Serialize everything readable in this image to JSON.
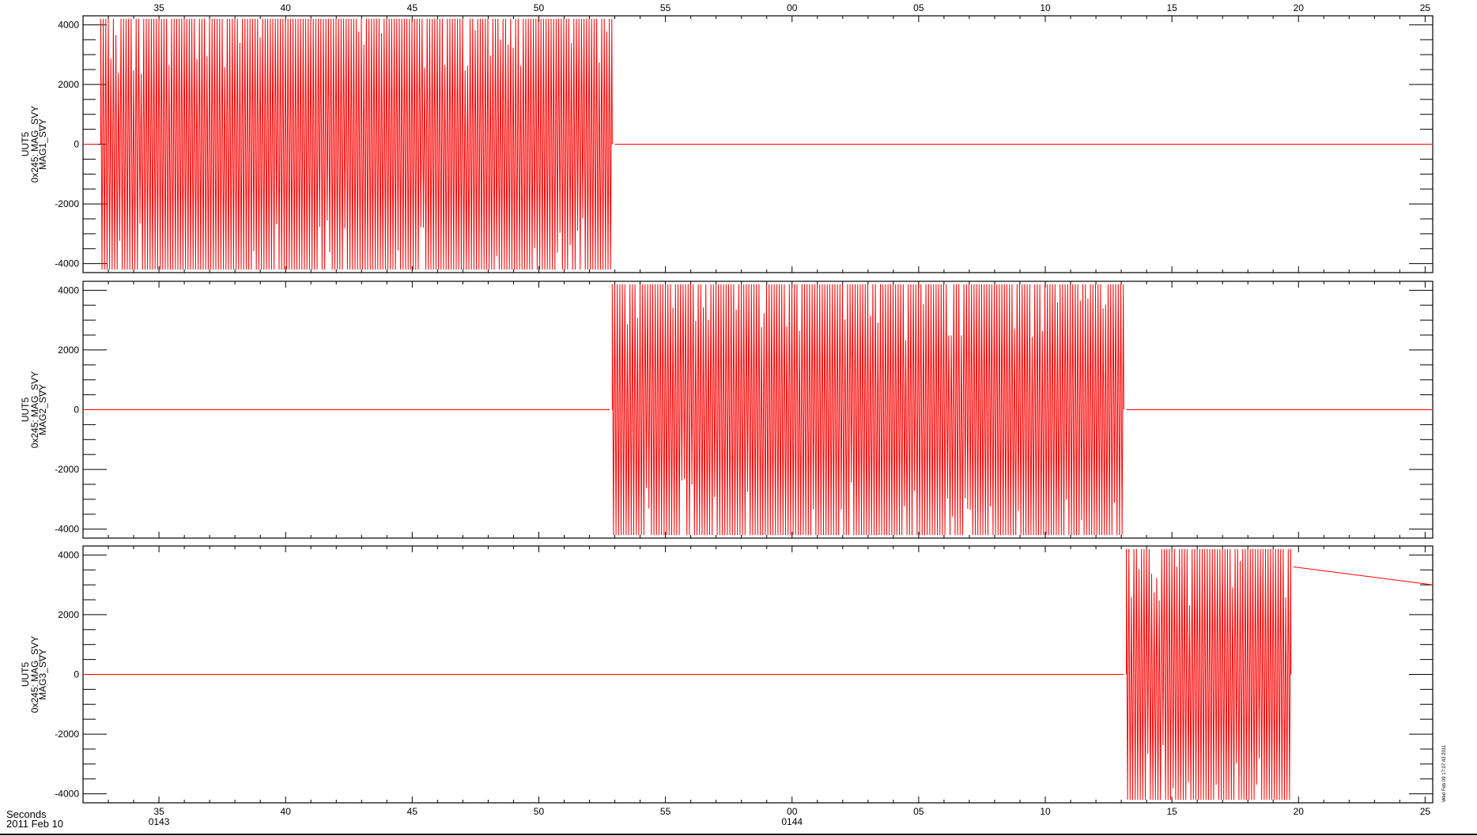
{
  "chart_data": [
    {
      "type": "line",
      "ylabel_lines": [
        "UUT5",
        "0x245: MAG_SVY",
        "MAG1_SVY"
      ],
      "y_ticks": [
        "4000",
        "2000",
        "0",
        "-2000",
        "-4000"
      ],
      "ylim": [
        -4300,
        4300
      ],
      "series": [
        {
          "color": "#ff0000",
          "segments": [
            {
              "kind": "flat",
              "x_start": "01:43:32.0",
              "x_end": "01:43:32.6",
              "value": 0
            },
            {
              "kind": "oscillation",
              "x_start": "01:43:32.7",
              "x_end": "01:43:52.9",
              "min": -4200,
              "max": 4200
            },
            {
              "kind": "flat",
              "x_start": "01:43:53.0",
              "x_end": "01:44:25.3",
              "value": 0
            }
          ]
        }
      ]
    },
    {
      "type": "line",
      "ylabel_lines": [
        "UUT5",
        "0x245: MAG_SVY",
        "MAG2_SVY"
      ],
      "y_ticks": [
        "4000",
        "2000",
        "0",
        "-2000",
        "-4000"
      ],
      "ylim": [
        -4300,
        4300
      ],
      "series": [
        {
          "color": "#ff0000",
          "segments": [
            {
              "kind": "flat",
              "x_start": "01:43:32.0",
              "x_end": "01:43:52.8",
              "value": 0
            },
            {
              "kind": "oscillation",
              "x_start": "01:43:52.9",
              "x_end": "01:44:13.1",
              "min": -4200,
              "max": 4200
            },
            {
              "kind": "flat",
              "x_start": "01:44:13.2",
              "x_end": "01:44:25.3",
              "value": 0
            }
          ]
        }
      ]
    },
    {
      "type": "line",
      "ylabel_lines": [
        "UUT5",
        "0x245: MAG_SVY",
        "MAG3_SVY"
      ],
      "y_ticks": [
        "4000",
        "2000",
        "0",
        "-2000",
        "-4000"
      ],
      "ylim": [
        -4300,
        4300
      ],
      "series": [
        {
          "color": "#ff0000",
          "segments": [
            {
              "kind": "flat",
              "x_start": "01:43:32.0",
              "x_end": "01:44:13.1",
              "value": 0
            },
            {
              "kind": "oscillation",
              "x_start": "01:44:13.2",
              "x_end": "01:44:19.7",
              "min": -4200,
              "max": 4200
            },
            {
              "kind": "line",
              "x_start": "01:44:19.8",
              "x_end": "01:44:25.3",
              "value_start": 3600,
              "value_end": 3000
            }
          ]
        }
      ]
    }
  ],
  "x_axis": {
    "xlim_seconds": [
      32.0,
      85.3
    ],
    "tick_seconds": [
      35,
      40,
      45,
      50,
      55,
      60,
      65,
      70,
      75,
      80,
      85
    ],
    "tick_labels": [
      "35",
      "40",
      "45",
      "50",
      "55",
      "00",
      "05",
      "10",
      "15",
      "20",
      "25"
    ],
    "minute_labels": [
      {
        "at_seconds": 35,
        "text": "0143"
      },
      {
        "at_seconds": 60,
        "text": "0144"
      }
    ],
    "units_label": "Seconds",
    "date_label": "2011 Feb 10"
  },
  "timestamp": "Wed Feb 09 17:07:43 2011",
  "colors": {
    "trace": "#ff0000",
    "axes": "#000000",
    "background": "#ffffff"
  }
}
